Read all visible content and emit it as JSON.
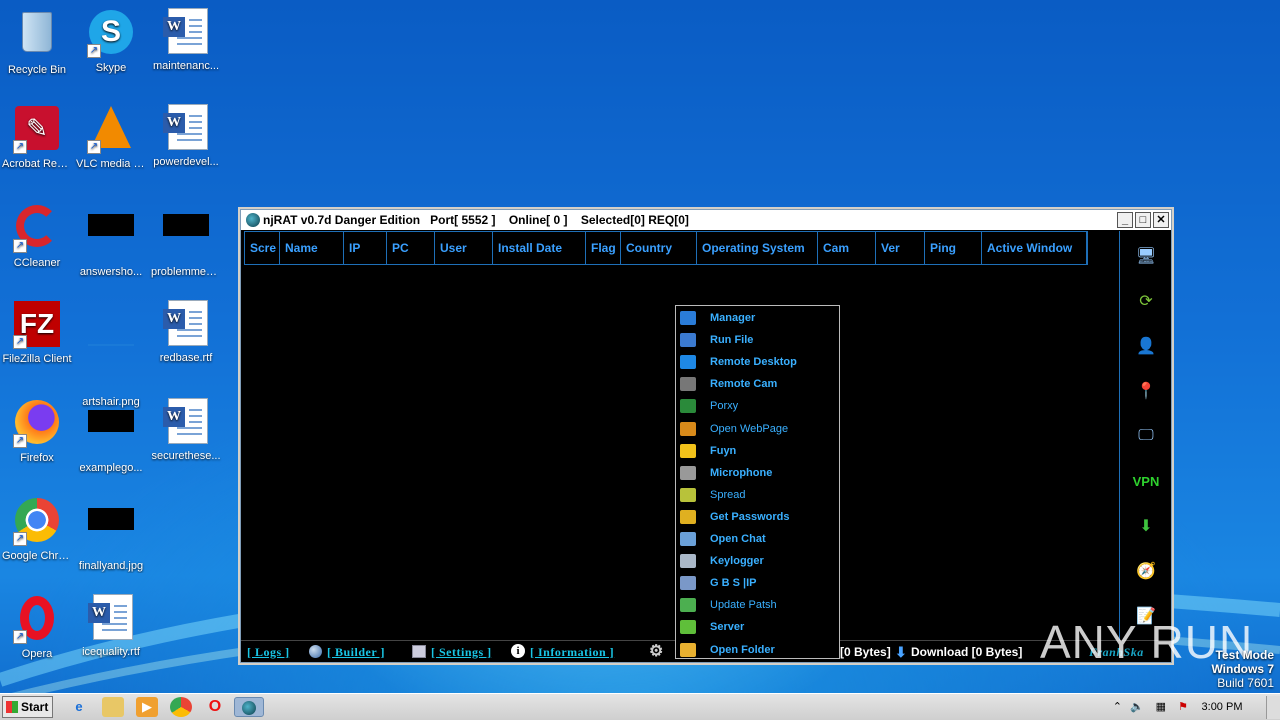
{
  "desktop": {
    "icons": [
      {
        "label": "Recycle Bin"
      },
      {
        "label": "Skype"
      },
      {
        "label": "maintenanc..."
      },
      {
        "label": "Acrobat Reader DC"
      },
      {
        "label": "VLC media player"
      },
      {
        "label": "powerdevel..."
      },
      {
        "label": "CCleaner"
      },
      {
        "label": "answersho..."
      },
      {
        "label": "problemmea..."
      },
      {
        "label": "FileZilla Client"
      },
      {
        "label": "artshair.png"
      },
      {
        "label": "redbase.rtf"
      },
      {
        "label": "Firefox"
      },
      {
        "label": "examplego..."
      },
      {
        "label": "securethese..."
      },
      {
        "label": "Google Chrome"
      },
      {
        "label": "finallyand.jpg"
      },
      {
        "label": "Opera"
      },
      {
        "label": "icequality.rtf"
      }
    ]
  },
  "window": {
    "title": "njRAT v0.7d Danger Edition",
    "port": "Port[ 5552 ]",
    "online": "Online[ 0 ]",
    "selected": "Selected[0] REQ[0]",
    "buttons": {
      "minimize": "_",
      "maximize": "□",
      "close": "✕"
    },
    "columns": [
      "Scre",
      "Name",
      "IP",
      "PC",
      "User",
      "Install Date",
      "Flag",
      "Country",
      "Operating System",
      "Cam",
      "Ver",
      "Ping",
      "Active Window"
    ],
    "sidebar": [
      "monitor-icon",
      "refresh-icon",
      "user-icon",
      "location-icon",
      "screen-icon",
      "VPN",
      "download-icon",
      "compass-icon",
      "notes-icon"
    ],
    "sidebar_vpn_label": "VPN",
    "status": {
      "logs": "[ Logs ]",
      "builder": "[ Builder ]",
      "settings": "[ Settings ]",
      "information": "[ Information ]",
      "upload_fragment": "[0 Bytes]",
      "download": "Download [0 Bytes]",
      "brand": "FranhSka"
    }
  },
  "context_menu": {
    "items": [
      {
        "label": "Manager",
        "bold": true,
        "color": "#2a7cd8"
      },
      {
        "label": "Run File",
        "bold": true,
        "color": "#3b7ad0"
      },
      {
        "label": "Remote Desktop",
        "bold": true,
        "color": "#1e88e5"
      },
      {
        "label": "Remote Cam",
        "bold": true,
        "color": "#777777"
      },
      {
        "label": "Porxy",
        "bold": false,
        "color": "#2a8a3a"
      },
      {
        "label": "Open WebPage",
        "bold": false,
        "color": "#d88a1a"
      },
      {
        "label": "Fuyn",
        "bold": true,
        "color": "#f2c21a"
      },
      {
        "label": "Microphone",
        "bold": true,
        "color": "#999999"
      },
      {
        "label": "Spread",
        "bold": false,
        "color": "#b8c23a"
      },
      {
        "label": "Get Passwords",
        "bold": true,
        "color": "#e0b020"
      },
      {
        "label": "Open Chat",
        "bold": true,
        "color": "#6aa0d8"
      },
      {
        "label": "Keylogger",
        "bold": true,
        "color": "#aab8c8"
      },
      {
        "label": "G B S |IP",
        "bold": true,
        "color": "#7a98c8"
      },
      {
        "label": "Update Patsh",
        "bold": false,
        "color": "#4caf50"
      },
      {
        "label": "Server",
        "bold": true,
        "color": "#5fbf3a"
      },
      {
        "label": "Open Folder",
        "bold": true,
        "color": "#e8b030"
      }
    ]
  },
  "taskbar": {
    "start": "Start",
    "time": "3:00 PM"
  },
  "watermark": "ANY RUN",
  "test_mode": {
    "line1": "Test Mode",
    "line2": "Windows 7",
    "line3": "Build 7601"
  }
}
